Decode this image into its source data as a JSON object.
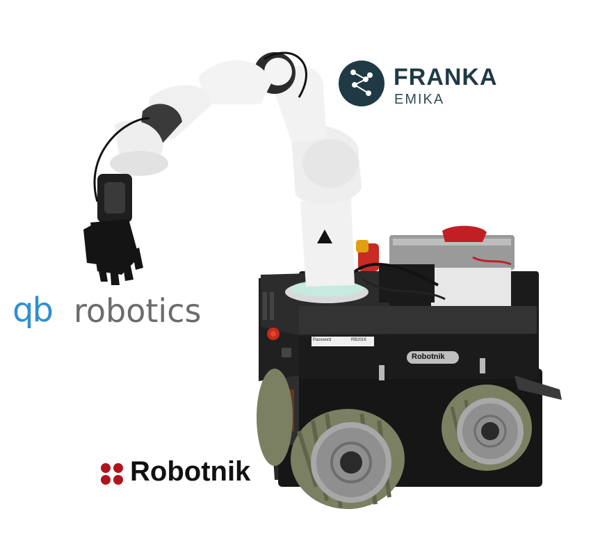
{
  "logos": {
    "franka": {
      "title": "FRANKA",
      "subtitle": "EMIKA",
      "color": "#1f3a45"
    },
    "qb": {
      "mark": "qb",
      "name": "robotics",
      "mark_color": "#2f8fd0",
      "name_color": "#6b6b6b"
    },
    "robotnik": {
      "name": "Robotnik",
      "dots_color": "#b0141c"
    }
  },
  "robot": {
    "base_badge": "Robotnik",
    "panel_label_left": "Password",
    "panel_label_right": "RB2016",
    "arm_color": "#f1f1f1",
    "base_color": "#1b1b1b",
    "wheel_color": "#8a8f72"
  }
}
